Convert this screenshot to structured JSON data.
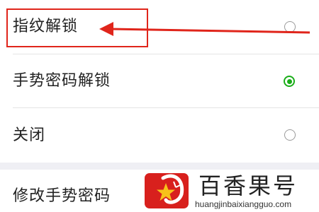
{
  "options": [
    {
      "label": "指纹解锁",
      "selected": false
    },
    {
      "label": "手势密码解锁",
      "selected": true
    },
    {
      "label": "关闭",
      "selected": false
    }
  ],
  "section2": {
    "modify_label": "修改手势密码"
  },
  "annotation": {
    "highlight_color": "#e0251b"
  },
  "watermark": {
    "title": "百香果号",
    "url": "huangjinbaixiangguo.com",
    "brand_color": "#d8201d"
  },
  "accent_color": "#1aad19"
}
